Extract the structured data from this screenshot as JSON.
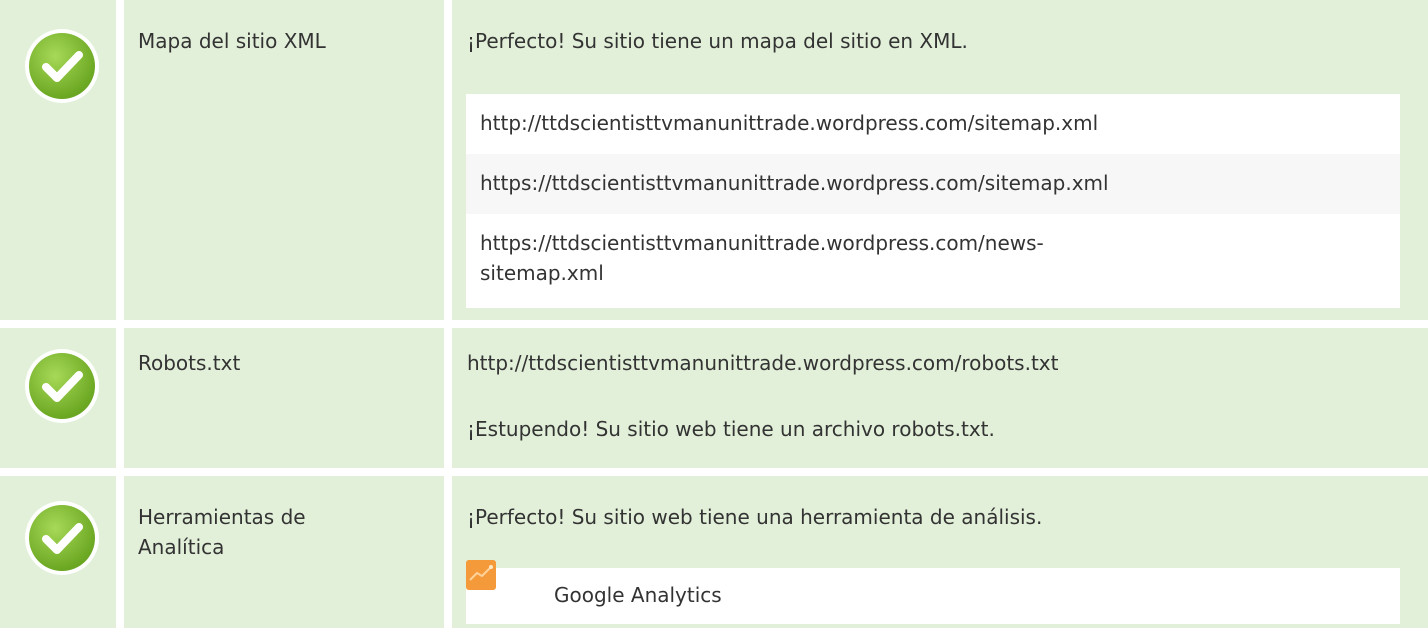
{
  "rows": [
    {
      "label": "Mapa del sitio XML",
      "message": "¡Perfecto! Su sitio tiene un mapa del sitio en XML.",
      "urls": [
        "http://ttdscientisttvmanunittrade.wordpress.com/sitemap.xml",
        "https://ttdscientisttvmanunittrade.wordpress.com/sitemap.xml",
        "https://ttdscientisttvmanunittrade.wordpress.com/news-",
        "sitemap.xml"
      ],
      "status_icon": "check-icon"
    },
    {
      "label": "Robots.txt",
      "url": "http://ttdscientisttvmanunittrade.wordpress.com/robots.txt",
      "message": "¡Estupendo! Su sitio web tiene un archivo robots.txt.",
      "status_icon": "check-icon"
    },
    {
      "label_line1": "Herramientas de",
      "label_line2": "Analítica",
      "message": "¡Perfecto! Su sitio web tiene una herramienta de análisis.",
      "tool": "Google Analytics",
      "status_icon": "check-icon",
      "tool_icon": "google-analytics-icon"
    }
  ],
  "colors": {
    "row_bg": "#e2f0d9",
    "check_green": "#78b72a",
    "check_green_light": "#9ad14a",
    "ga_orange": "#f59a3b"
  }
}
